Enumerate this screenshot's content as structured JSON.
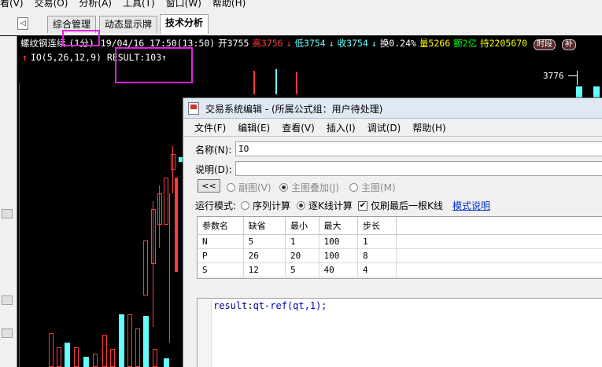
{
  "menubar": {
    "items": [
      "看(V)",
      "交易(O)",
      "分析(A)",
      "工具(T)",
      "窗口(W)",
      "帮助(H)"
    ]
  },
  "tabs": {
    "nav_arrow": "◁",
    "items": [
      "综合管理",
      "动态显示牌",
      "技术分析"
    ],
    "active": 2
  },
  "chart_header": {
    "name": "螺纹钢连续",
    "period": "(1分)",
    "datetime": "19/04/16 17:50(13:50)",
    "open": "开3755",
    "high": "高3756",
    "low": "低3754",
    "close": "收3754",
    "turnover": "换0.24%",
    "volume": "量5266",
    "amount": "额2亿",
    "position": "持2205670",
    "badge1": "时段",
    "badge2": "补"
  },
  "indicator_line": {
    "formula": "IO(5,26,12,9)",
    "result": "RESULT:103"
  },
  "price_marker": "3776",
  "colors": {
    "chart_bg": "#000000",
    "up": "#ff3b3b",
    "down": "#64ffff",
    "highlight": "#e020e0"
  },
  "dialog": {
    "title": "交易系统编辑 - (所属公式组：用户待处理)",
    "menu": [
      "文件(F)",
      "编辑(E)",
      "查看(V)",
      "插入(I)",
      "调试(D)",
      "帮助(H)"
    ],
    "name_label": "名称(N):",
    "name_value": "IO",
    "desc_label": "说明(D):",
    "desc_value": "",
    "back_button": "<<",
    "view_options": [
      "副图(V)",
      "主图叠加(J)",
      "主图(M)"
    ],
    "run_mode_label": "运行模式:",
    "run_modes": [
      "序列计算",
      "逐K线计算"
    ],
    "last_bar_only": "仅刷最后一根K线",
    "model_doc_link": "模式说明",
    "param_table": {
      "headers": [
        "参数名",
        "缺省",
        "最小",
        "最大",
        "步长"
      ],
      "rows": [
        [
          "N",
          "5",
          "1",
          "100",
          "1"
        ],
        [
          "P",
          "26",
          "20",
          "100",
          "8"
        ],
        [
          "S",
          "12",
          "5",
          "40",
          "4"
        ],
        [
          "",
          "",
          "",
          "",
          ""
        ]
      ]
    },
    "code": {
      "var": "result",
      "sep": ":",
      "expr": "qt-ref(qt,1);"
    }
  }
}
